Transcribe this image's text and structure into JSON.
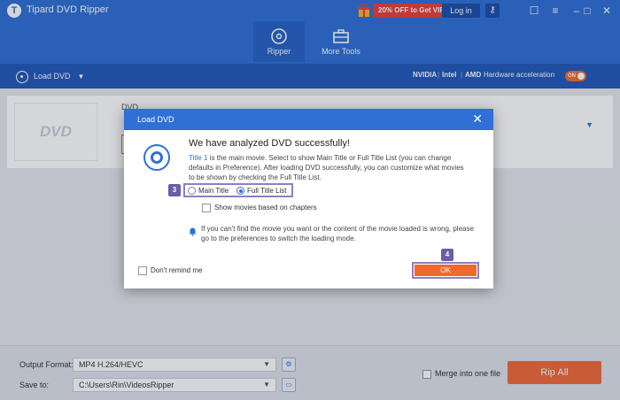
{
  "app": {
    "title": "Tipard DVD Ripper",
    "logo_letter": "T"
  },
  "header": {
    "promo": "20% OFF to Get VIP",
    "login": "Log in",
    "tabs": [
      {
        "label": "Ripper",
        "icon": "disc-icon",
        "active": true
      },
      {
        "label": "More Tools",
        "icon": "toolbox-icon",
        "active": false
      }
    ]
  },
  "toolbar": {
    "load_dvd": "Load DVD",
    "gpu_vendors": [
      "NVIDIA",
      "Intel",
      "AMD"
    ],
    "hw_accel_label": "Hardware acceleration",
    "hw_toggle": "ON"
  },
  "card": {
    "label": "DVD",
    "thumb_logo": "DVD"
  },
  "bottom": {
    "output_format_label": "Output Format:",
    "output_format_value": "MP4 H.264/HEVC",
    "save_to_label": "Save to:",
    "save_to_value": "C:\\Users\\Rin\\VideosRipper",
    "merge_label": "Merge into one file",
    "rip_all": "Rip All"
  },
  "dialog": {
    "title": "Load DVD",
    "heading": "We have analyzed DVD successfully!",
    "desc_link": "Title 1",
    "desc_rest": " is the main movie. Select to show Main Title or Full Title List (you can change defaults in Preference). After loading DVD successfully, you can customize what movies to be shown by checking the Full Title List.",
    "options": [
      {
        "label": "Main Title",
        "selected": false
      },
      {
        "label": "Full Title List",
        "selected": true
      }
    ],
    "chapters_label": "Show movies based on chapters",
    "hint": "If you can't find the movie you want or the content of the movie loaded is wrong, please go to the preferences to switch the loading mode.",
    "dont_remind": "Don't remind me",
    "ok": "OK",
    "step_labels": [
      "3",
      "4"
    ]
  },
  "colors": {
    "brand_blue": "#2f6fd6",
    "accent_orange": "#f06a2c",
    "highlight_purple": "#8c7fc4"
  }
}
